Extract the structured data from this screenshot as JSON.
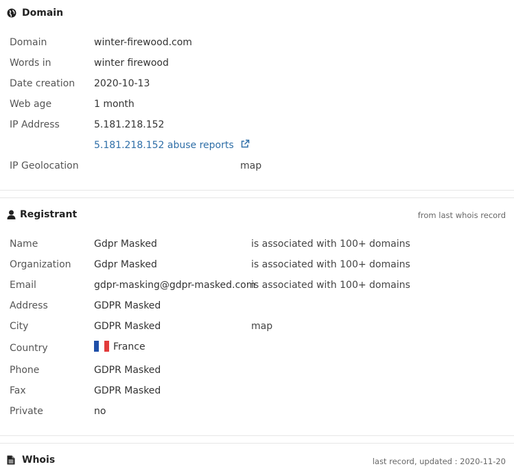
{
  "domain_section": {
    "title": "Domain",
    "rows": {
      "domain": {
        "label": "Domain",
        "value": "winter-firewood.com"
      },
      "words": {
        "label": "Words in",
        "value": "winter firewood"
      },
      "date": {
        "label": "Date creation",
        "value": "2020-10-13"
      },
      "age": {
        "label": "Web age",
        "value": "1 month"
      },
      "ip": {
        "label": "IP Address",
        "value": "5.181.218.152"
      },
      "abuse": {
        "value": "5.181.218.152 abuse reports"
      },
      "geo": {
        "label": "IP Geolocation",
        "map": "map"
      }
    }
  },
  "registrant": {
    "title": "Registrant",
    "note": "from last whois record",
    "rows": {
      "name": {
        "label": "Name",
        "value": "Gdpr Masked",
        "assoc": "is associated with 100+ domains"
      },
      "org": {
        "label": "Organization",
        "value": "Gdpr Masked",
        "assoc": "is associated with 100+ domains"
      },
      "email": {
        "label": "Email",
        "value": "gdpr-masking@gdpr-masked.com",
        "assoc": "is associated with 100+ domains"
      },
      "address": {
        "label": "Address",
        "value": "GDPR Masked"
      },
      "city": {
        "label": "City",
        "value": "GDPR Masked",
        "map": "map"
      },
      "country": {
        "label": "Country",
        "value": "France"
      },
      "phone": {
        "label": "Phone",
        "value": "GDPR Masked"
      },
      "fax": {
        "label": "Fax",
        "value": "GDPR Masked"
      },
      "private": {
        "label": "Private",
        "value": "no"
      }
    }
  },
  "whois": {
    "title": "Whois",
    "note": "last record, updated : 2020-11-20"
  },
  "colors": {
    "link": "#2e6ea7",
    "flag_blue": "#1f4fa8",
    "flag_red": "#e23b3b"
  },
  "icons": {
    "domain": "globe-icon",
    "registrant": "user-icon",
    "whois": "file-icon",
    "external": "external-link-icon"
  }
}
